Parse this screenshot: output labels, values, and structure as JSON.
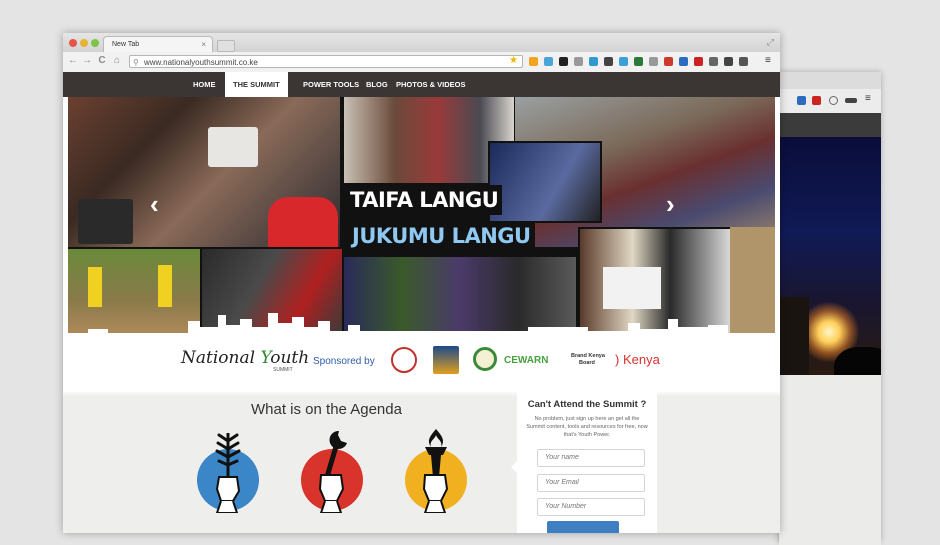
{
  "browser": {
    "tab_title": "New Tab",
    "tab_close": "×",
    "url": "www.nationalyouthsummit.co.ke",
    "nav_back": "←",
    "nav_forward": "→",
    "nav_reload": "C",
    "nav_home": "⌂",
    "star": "★",
    "menu": "≡",
    "resize": "⤢",
    "extension_colors": [
      "#f3a31f",
      "#4aa6d9",
      "#222222",
      "#9a9a9a",
      "#2e9ad0",
      "#444444",
      "#3aa0d8",
      "#2c7a3a",
      "#999999",
      "#cc3a2a",
      "#2c6bbf",
      "#cc2222",
      "#666666",
      "#444444",
      "#555555"
    ]
  },
  "site": {
    "nav": [
      {
        "label": "HOME"
      },
      {
        "label": "THE SUMMIT"
      },
      {
        "label": "POWER TOOLS"
      },
      {
        "label": "BLOG"
      },
      {
        "label": "PHOTOS & VIDEOS"
      }
    ],
    "hero": {
      "slogan_line1": "TAIFA LANGU",
      "slogan_line2": "JUKUMU LANGU",
      "prev_arrow": "‹",
      "next_arrow": "›"
    },
    "sponsors": {
      "logo_text_a": "National ",
      "logo_text_v": "Y",
      "logo_text_b": "outh",
      "logo_sub": "SUMMIT",
      "sponsored_by": "Sponsored by",
      "cewarn": "CEWARN",
      "brand_kenya_line1": "Brand Kenya",
      "brand_kenya_line2": "Board",
      "kenya": ") Kenya"
    },
    "agenda": {
      "title": "What is on the Agenda",
      "circle_colors": [
        "#3b86c6",
        "#d9342b",
        "#f0b020"
      ]
    },
    "signup": {
      "title": "Can't Attend the Summit ?",
      "description": "No problem, just sign up here an get all the Summit content, tools and resources for free, now that's Youth Power.",
      "name_placeholder": "Your name",
      "email_placeholder": "Your Email",
      "number_placeholder": "Your Number"
    }
  },
  "colors": {
    "nav_bg": "#3b3533",
    "accent_blue": "#3d7fc1",
    "kenya_red": "#d9322c"
  }
}
